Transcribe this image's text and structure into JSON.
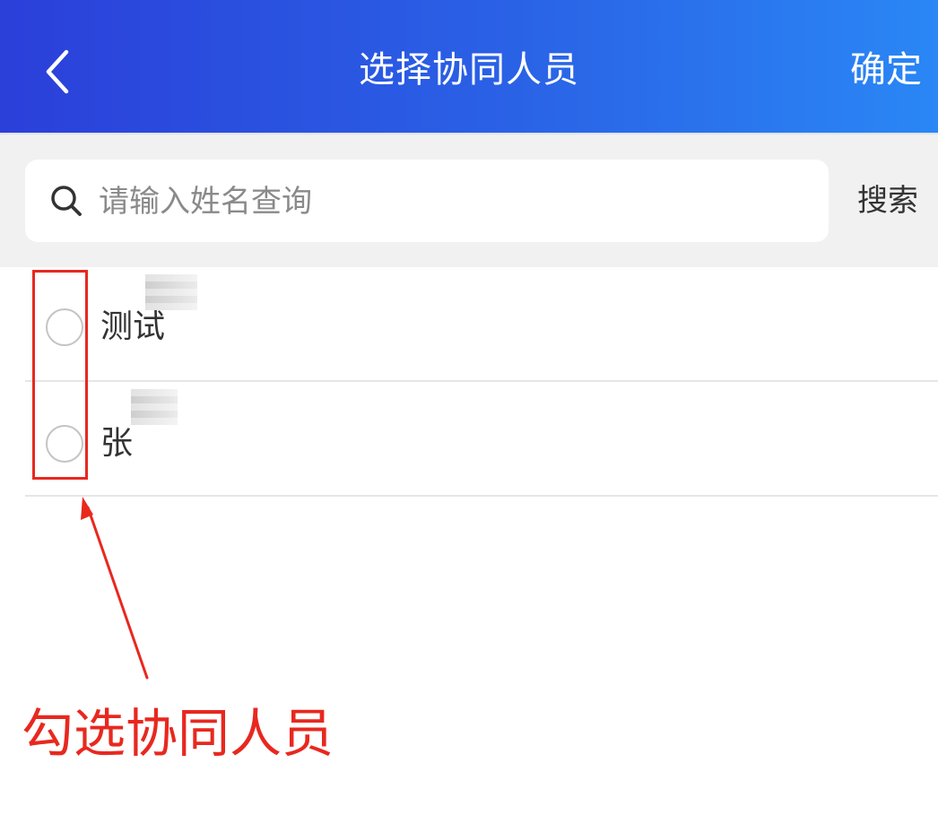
{
  "header": {
    "title": "选择协同人员",
    "confirm_label": "确定",
    "back_icon": "chevron-left-icon"
  },
  "search": {
    "placeholder": "请输入姓名查询",
    "button_label": "搜索",
    "icon": "search-icon"
  },
  "members": [
    {
      "name": "测试",
      "selected": false
    },
    {
      "name": "张",
      "selected": false
    }
  ],
  "annotation": {
    "text": "勾选协同人员",
    "color": "#e8281f"
  },
  "colors": {
    "header_start": "#2b3fd9",
    "header_end": "#2a87f5",
    "background_gray": "#f1f1f1"
  }
}
